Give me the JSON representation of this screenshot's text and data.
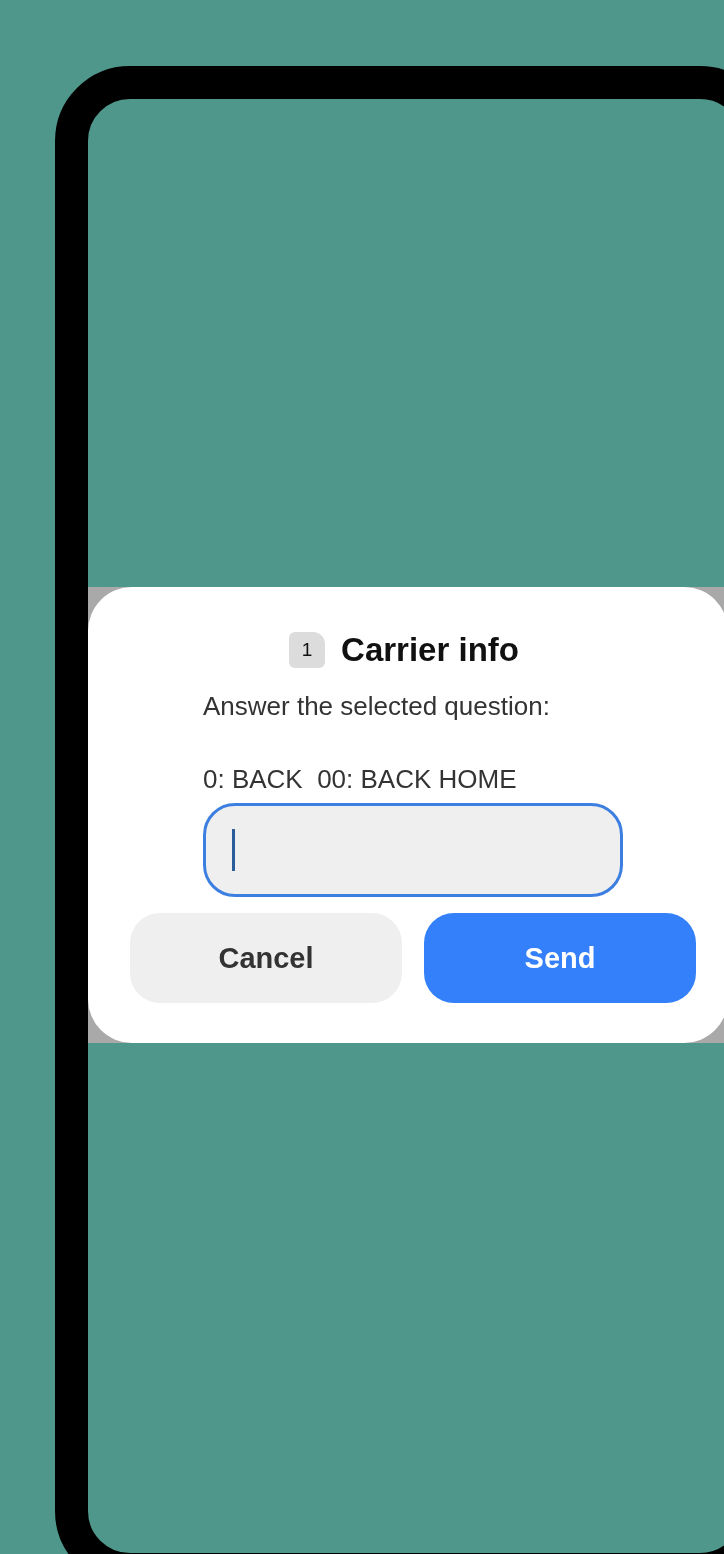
{
  "dialog": {
    "sim_badge": "1",
    "title": "Carrier info",
    "message": "Answer the selected question:",
    "hint": "0: BACK  00: BACK HOME",
    "field": {
      "focused": true
    },
    "buttons": [
      {
        "label": "Cancel",
        "kind": "secondary"
      },
      {
        "label": "Send",
        "kind": "primary"
      }
    ]
  }
}
